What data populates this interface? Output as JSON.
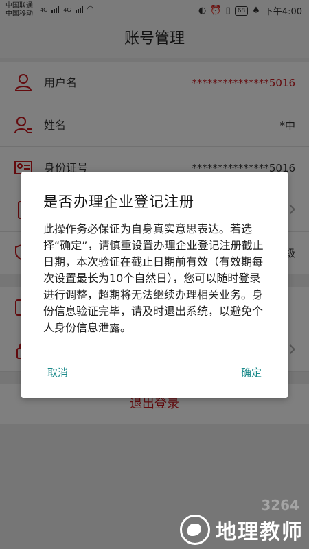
{
  "status_bar": {
    "carrier1": "中国联通",
    "carrier2": "中国移动",
    "net1": "4G",
    "net2": "4G",
    "battery": "68",
    "time": "下午4:00"
  },
  "title": "账号管理",
  "account_rows": [
    {
      "label": "用户名",
      "value": "***************5016",
      "icon": "user-icon"
    },
    {
      "label": "姓名",
      "value": "*中",
      "icon": "person-card-icon"
    },
    {
      "label": "身份证号",
      "value": "***************5016",
      "icon": "id-card-icon"
    },
    {
      "label": "",
      "value": "",
      "icon": "phone-icon"
    },
    {
      "label": "",
      "value": "级",
      "icon": "shield-icon"
    }
  ],
  "security_rows": [
    {
      "label": "",
      "icon": "face-id-icon"
    },
    {
      "label": "",
      "icon": "lock-icon"
    }
  ],
  "logout_label": "退出登录",
  "dialog": {
    "title": "是否办理企业登记注册",
    "message": "此操作务必保证为自身真实意思表达。若选择“确定”，请慎重设置办理企业登记注册截止日期，本次验证在截止日期前有效（有效期每次设置最长为10个自然日），您可以随时登录进行调整，超期将无法继续办理相关业务。身份信息验证完毕，请及时退出系统，以避免个人身份信息泄露。",
    "cancel": "取消",
    "confirm": "确定"
  },
  "watermark": {
    "text": "地理教师",
    "faint": "3264"
  },
  "colors": {
    "accent_red": "#c8161d",
    "dialog_button": "#1b8a8a"
  }
}
